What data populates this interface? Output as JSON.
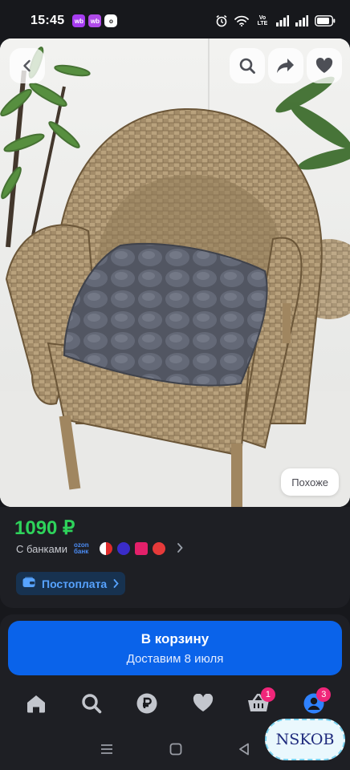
{
  "status_bar": {
    "time": "15:45",
    "apps": [
      "wb",
      "wb",
      "o"
    ],
    "network_label": "Vo LTE",
    "battery": "80%"
  },
  "product": {
    "similar_label": "Похоже",
    "price": "1090 ₽",
    "banks_label": "С банками",
    "ozon_bank": "ozon банк",
    "postpay_label": "Постоплата"
  },
  "cart": {
    "title": "В корзину",
    "subtitle": "Доставим 8 июля"
  },
  "nav": {
    "items": [
      {
        "name": "home-icon"
      },
      {
        "name": "search-icon"
      },
      {
        "name": "ruble-icon"
      },
      {
        "name": "heart-icon"
      },
      {
        "name": "cart-icon",
        "badge": "1"
      },
      {
        "name": "profile-icon",
        "badge": "3"
      }
    ]
  },
  "watermark": "NSKOB",
  "colors": {
    "price_green": "#2ed35b",
    "accent_blue": "#0a63ea",
    "badge_pink": "#f0267a"
  }
}
